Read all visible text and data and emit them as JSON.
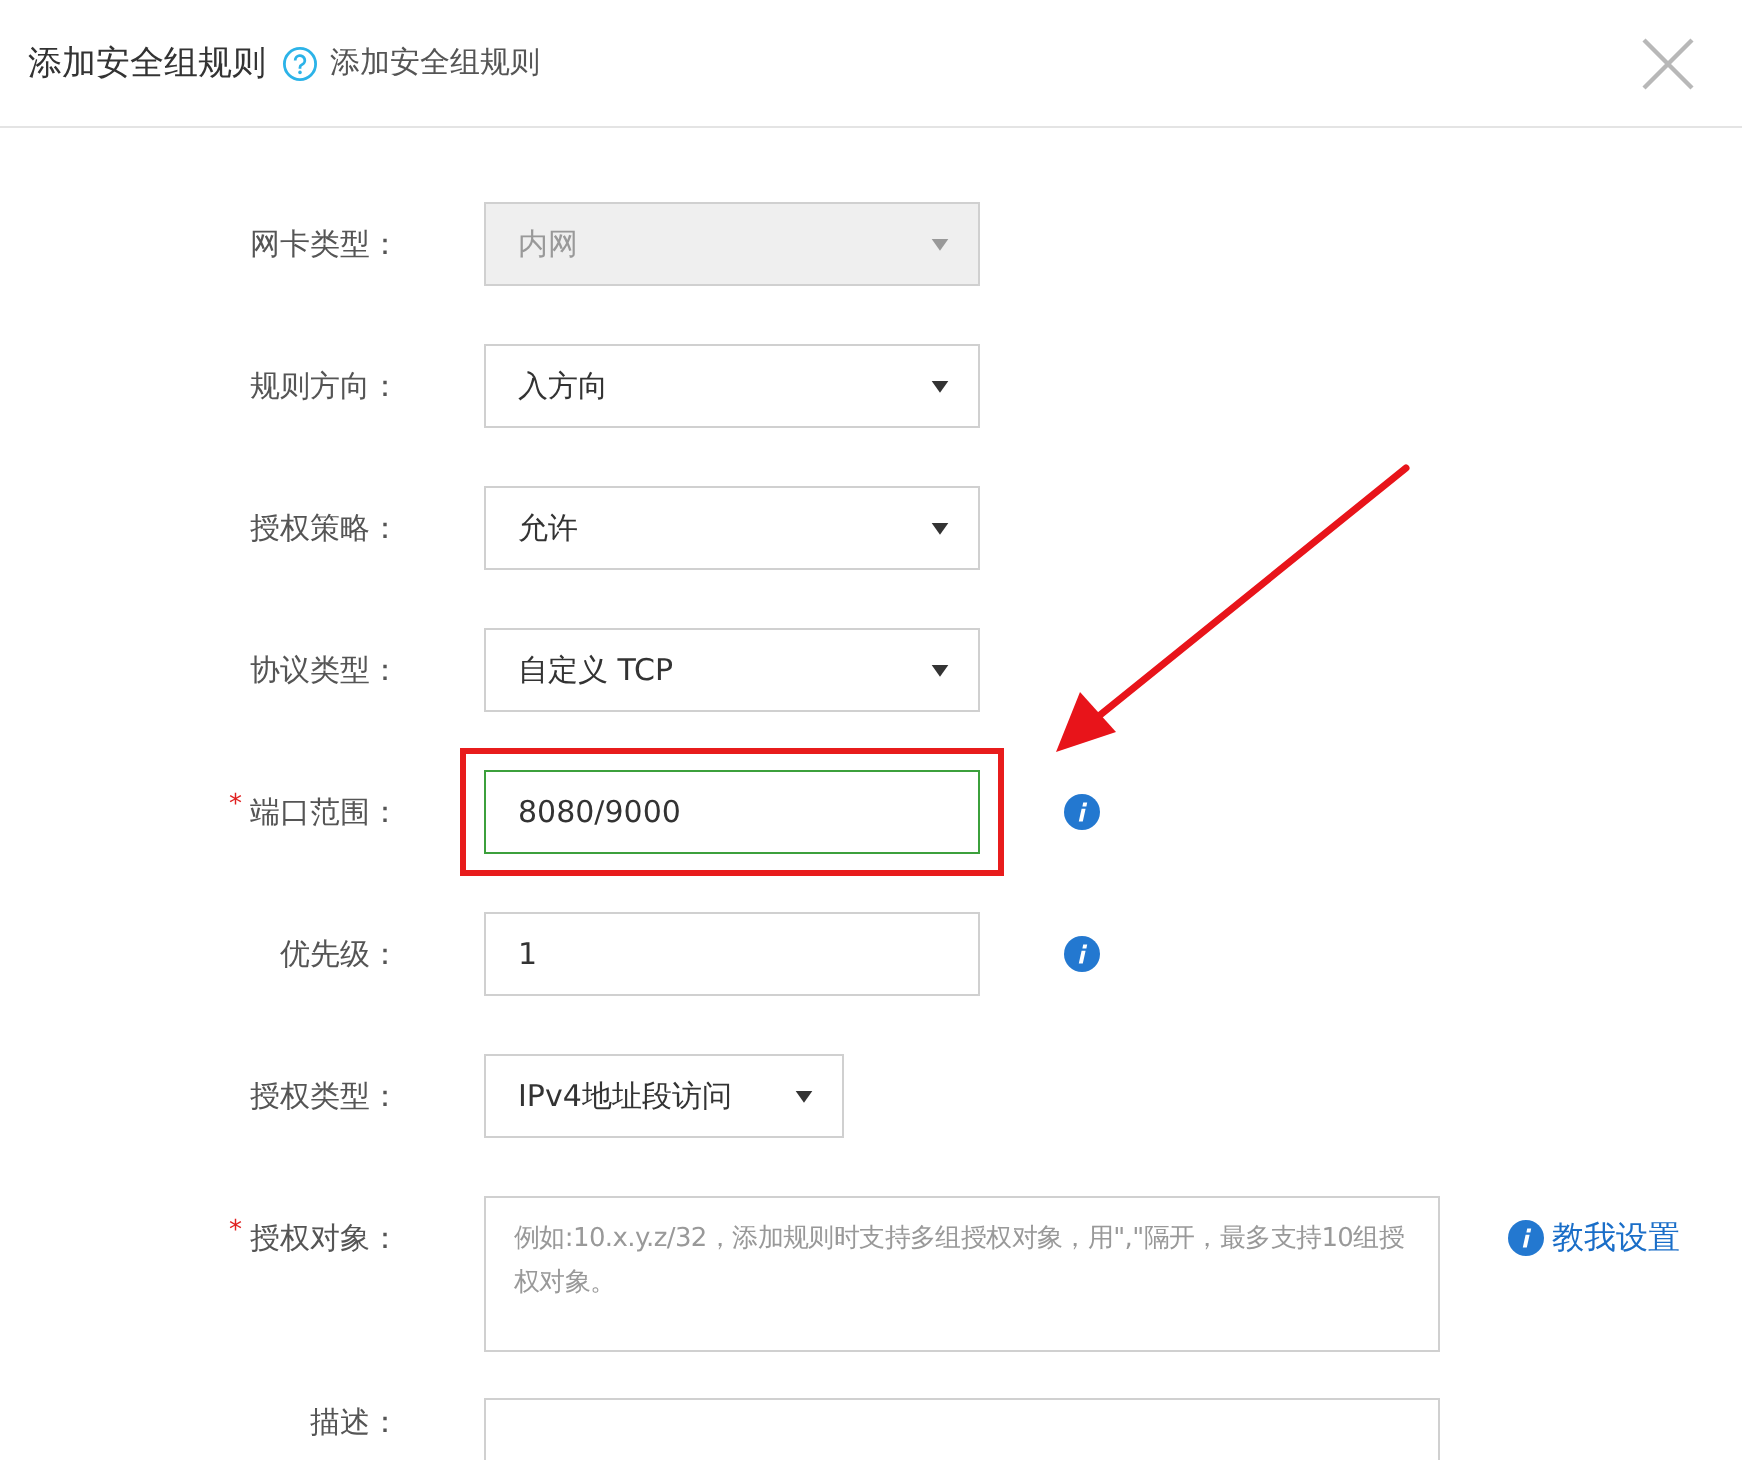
{
  "dialog": {
    "title": "添加安全组规则",
    "subtitle": "添加安全组规则"
  },
  "rows": [
    {
      "kind": "select",
      "label": "网卡类型：",
      "value": "内网",
      "disabled": true,
      "compact": false,
      "info": false,
      "highlighted": false
    },
    {
      "kind": "select",
      "label": "规则方向：",
      "value": "入方向",
      "disabled": false,
      "compact": false,
      "info": false,
      "highlighted": false
    },
    {
      "kind": "select",
      "label": "授权策略：",
      "value": "允许",
      "disabled": false,
      "compact": false,
      "info": false,
      "highlighted": false
    },
    {
      "kind": "select",
      "label": "协议类型：",
      "value": "自定义 TCP",
      "disabled": false,
      "compact": false,
      "info": false,
      "highlighted": false
    },
    {
      "kind": "input",
      "label": "端口范围：",
      "required_mark": "*",
      "value": "8080/9000",
      "focused": true,
      "info": true,
      "highlighted": true
    },
    {
      "kind": "input",
      "label": "优先级：",
      "value": "1",
      "focused": false,
      "info": true,
      "highlighted": false
    },
    {
      "kind": "select",
      "label": "授权类型：",
      "value": "IPv4地址段访问",
      "disabled": false,
      "compact": true,
      "info": false,
      "highlighted": false
    },
    {
      "kind": "textarea",
      "label": "授权对象：",
      "required_mark": "*",
      "placeholder": "例如:10.x.y.z/32，添加规则时支持多组授权对象，用\",\"隔开，最多支持10组授权对象。",
      "info": false,
      "highlighted": false,
      "help_link": "教我设置"
    },
    {
      "kind": "input",
      "label": "描述：",
      "focused": false,
      "info": false,
      "highlighted": false
    }
  ],
  "annotations": [
    {
      "kind": "arrow"
    }
  ]
}
